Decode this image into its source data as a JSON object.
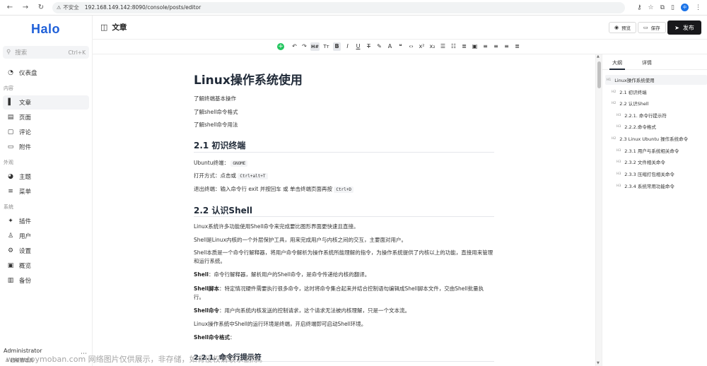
{
  "browser": {
    "insecure_label": "不安全",
    "url": "192.168.149.142:8090/console/posts/editor",
    "profile_initial": "中"
  },
  "sidebar": {
    "logo": "Halo",
    "search_placeholder": "搜索",
    "search_shortcut": "Ctrl+K",
    "dashboard": "仪表盘",
    "group_content": "内容",
    "posts": "文章",
    "pages": "页面",
    "comments": "评论",
    "attachments": "附件",
    "group_appearance": "外观",
    "themes": "主题",
    "menus": "菜单",
    "group_system": "系统",
    "plugins": "插件",
    "users": "用户",
    "settings": "设置",
    "overview": "概览",
    "backup": "备份",
    "user_name": "Administrator",
    "user_role": "超级管理员"
  },
  "header": {
    "title": "文章",
    "preview": "预览",
    "save": "保存",
    "publish": "发布"
  },
  "panel": {
    "tab_outline": "大纲",
    "tab_detail": "详情",
    "outline": [
      {
        "level": "H1",
        "text": "Linux操作系统使用"
      },
      {
        "level": "H2",
        "text": "2.1 初识终端"
      },
      {
        "level": "H2",
        "text": "2.2 认识Shell"
      },
      {
        "level": "H3",
        "text": "2.2.1. 命令行提示符"
      },
      {
        "level": "H3",
        "text": "2.2.2.命令格式"
      },
      {
        "level": "H2",
        "text": "2.3 Linux Ubuntu 操作系统命令"
      },
      {
        "level": "H3",
        "text": "2.3.1 用户与系统相关命令"
      },
      {
        "level": "H3",
        "text": "2.3.2 文件相关命令"
      },
      {
        "level": "H3",
        "text": "2.3.3 压缩打包相关命令"
      },
      {
        "level": "H3",
        "text": "2.3.4 系统常用功能命令"
      }
    ]
  },
  "doc": {
    "h1": "Linux操作系统使用",
    "intro1": "了解终端基本操作",
    "intro2": "了解shell命令格式",
    "intro3": "了解shell命令用法",
    "h2_1": "2.1 初识终端",
    "ubuntu_label": "Ubuntu终端：",
    "ubuntu_code": "GNOME",
    "open_label": "打开方式：点击或",
    "open_code": "Ctrl+alt+T",
    "exit_label": "退出终端：输入命令行 exit 并按回车 或 单击终端页面再按",
    "exit_code": "Ctrl+D",
    "h2_2": "2.2 认识Shell",
    "p1": "Linux系统许多功能使用Shell命令来完成要比图形界面更快速且直接。",
    "p2": "Shell是Linux内核的一个外层保护工具，用来完成用户与内核之间的交互，主要面对用户。",
    "p3": "Shell本质是一个命令行解释器，将用户命令解析为操作系统所能理解的指令，为操作系统提供了内核以上的功能，直接用来管理和运行系统。",
    "p4_b": "Shell",
    "p4": "：命令行解释器，解析用户的Shell命令，是命令传递给内核的翻译。",
    "p5_b": "Shell脚本",
    "p5": "：特定情况硬件需要执行很多命令，这时将命令集合起来并结合控制语句编辑成Shell脚本文件，交由Shell批量执行。",
    "p6_b": "Shell命令",
    "p6": "：用户向系统内核发送的控制请求，这个请求无法被内核理解，只是一个文本流。",
    "p7": "Linux操作系统中Shell的运行环境是终端，开启终端即可启动Shell环境。",
    "p8_b": "Shell命令格式",
    "p8": "：",
    "h3_1": "2.2.1. 命令行提示符"
  },
  "watermark": "www.toymoban.com 网络图片仅供展示，非存储，如有侵权请联系删除。"
}
